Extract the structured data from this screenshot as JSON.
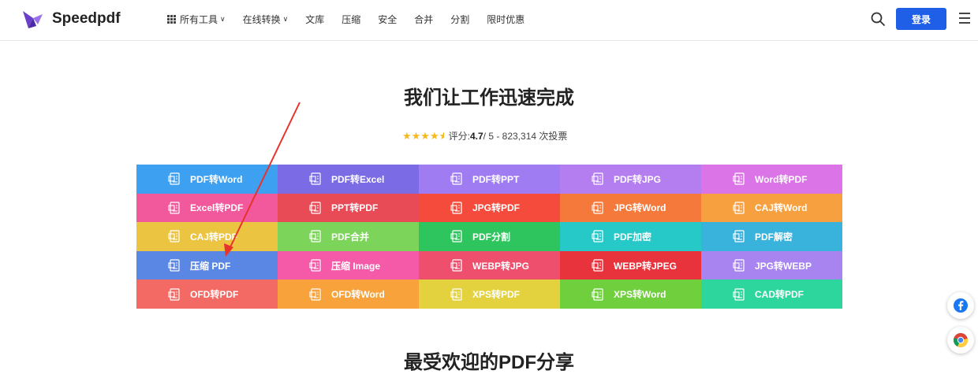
{
  "brand": {
    "name": "Speedpdf"
  },
  "nav": [
    {
      "label": "所有工具",
      "icon": "grid-icon",
      "dropdown": true
    },
    {
      "label": "在线转换",
      "dropdown": true
    },
    {
      "label": "文库"
    },
    {
      "label": "压缩"
    },
    {
      "label": "安全"
    },
    {
      "label": "合并"
    },
    {
      "label": "分割"
    },
    {
      "label": "限时优惠"
    }
  ],
  "header": {
    "login_label": "登录"
  },
  "hero": {
    "title": "我们让工作迅速完成",
    "rating_prefix": "评分: ",
    "rating_value": "4.7",
    "rating_suffix": " / 5 - 823,314 次投票",
    "stars": 4.5
  },
  "tools": [
    {
      "label": "PDF转Word",
      "color": "#3ea0f0"
    },
    {
      "label": "PDF转Excel",
      "color": "#7b6ce6"
    },
    {
      "label": "PDF转PPT",
      "color": "#a07cf2"
    },
    {
      "label": "PDF转JPG",
      "color": "#b57ef0"
    },
    {
      "label": "Word转PDF",
      "color": "#db74e6"
    },
    {
      "label": "Excel转PDF",
      "color": "#f2589c"
    },
    {
      "label": "PPT转PDF",
      "color": "#e84a56"
    },
    {
      "label": "JPG转PDF",
      "color": "#f44b3c"
    },
    {
      "label": "JPG转Word",
      "color": "#f5793a"
    },
    {
      "label": "CAJ转Word",
      "color": "#f6a040"
    },
    {
      "label": "CAJ转PDF",
      "color": "#ebc442"
    },
    {
      "label": "PDF合并",
      "color": "#7dd45a"
    },
    {
      "label": "PDF分割",
      "color": "#2fc55e"
    },
    {
      "label": "PDF加密",
      "color": "#27c8c8"
    },
    {
      "label": "PDF解密",
      "color": "#3ab3dc"
    },
    {
      "label": "压缩 PDF",
      "color": "#5a86e4"
    },
    {
      "label": "压缩 Image",
      "color": "#f55aa8"
    },
    {
      "label": "WEBP转JPG",
      "color": "#ee4f6c"
    },
    {
      "label": "WEBP转JPEG",
      "color": "#e8333c"
    },
    {
      "label": "JPG转WEBP",
      "color": "#a784f0"
    },
    {
      "label": "OFD转PDF",
      "color": "#f36a64"
    },
    {
      "label": "OFD转Word",
      "color": "#f8a23c"
    },
    {
      "label": "XPS转PDF",
      "color": "#e3d23e"
    },
    {
      "label": "XPS转Word",
      "color": "#6fcf3c"
    },
    {
      "label": "CAD转PDF",
      "color": "#2dd69c"
    }
  ],
  "section2": {
    "title": "最受欢迎的PDF分享"
  },
  "floating": [
    {
      "icon": "facebook-icon",
      "color": "#1877f2"
    },
    {
      "icon": "chrome-icon"
    }
  ]
}
